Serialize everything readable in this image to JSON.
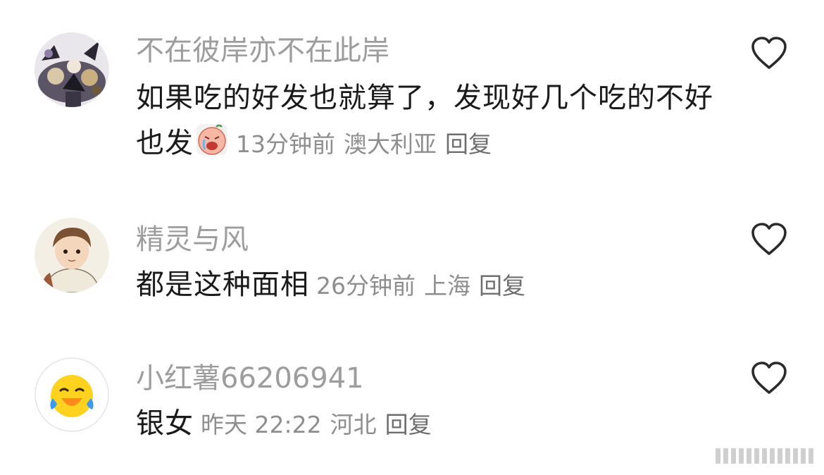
{
  "comments": [
    {
      "avatar": "anime-group-avatar",
      "username": "不在彼岸亦不在此岸",
      "text": "如果吃的好发也就算了，发现好几个吃的不好也发",
      "emoji": "crying-face-emoji",
      "time": "13分钟前",
      "location": "澳大利亚",
      "reply": "回复",
      "like_icon": "heart-outline-icon"
    },
    {
      "avatar": "cartoon-girl-avatar",
      "username": "精灵与风",
      "text": "都是这种面相",
      "time": "26分钟前",
      "location": "上海",
      "reply": "回复",
      "like_icon": "heart-outline-icon"
    },
    {
      "avatar": "laughing-emoji-avatar",
      "username": "小红薯66206941",
      "text": "银女",
      "time": "昨天 22:22",
      "location": "河北",
      "reply": "回复",
      "like_icon": "heart-outline-icon"
    }
  ],
  "colors": {
    "username": "#9d9d9d",
    "text": "#1a1a1a",
    "meta": "#8e8e8e"
  }
}
